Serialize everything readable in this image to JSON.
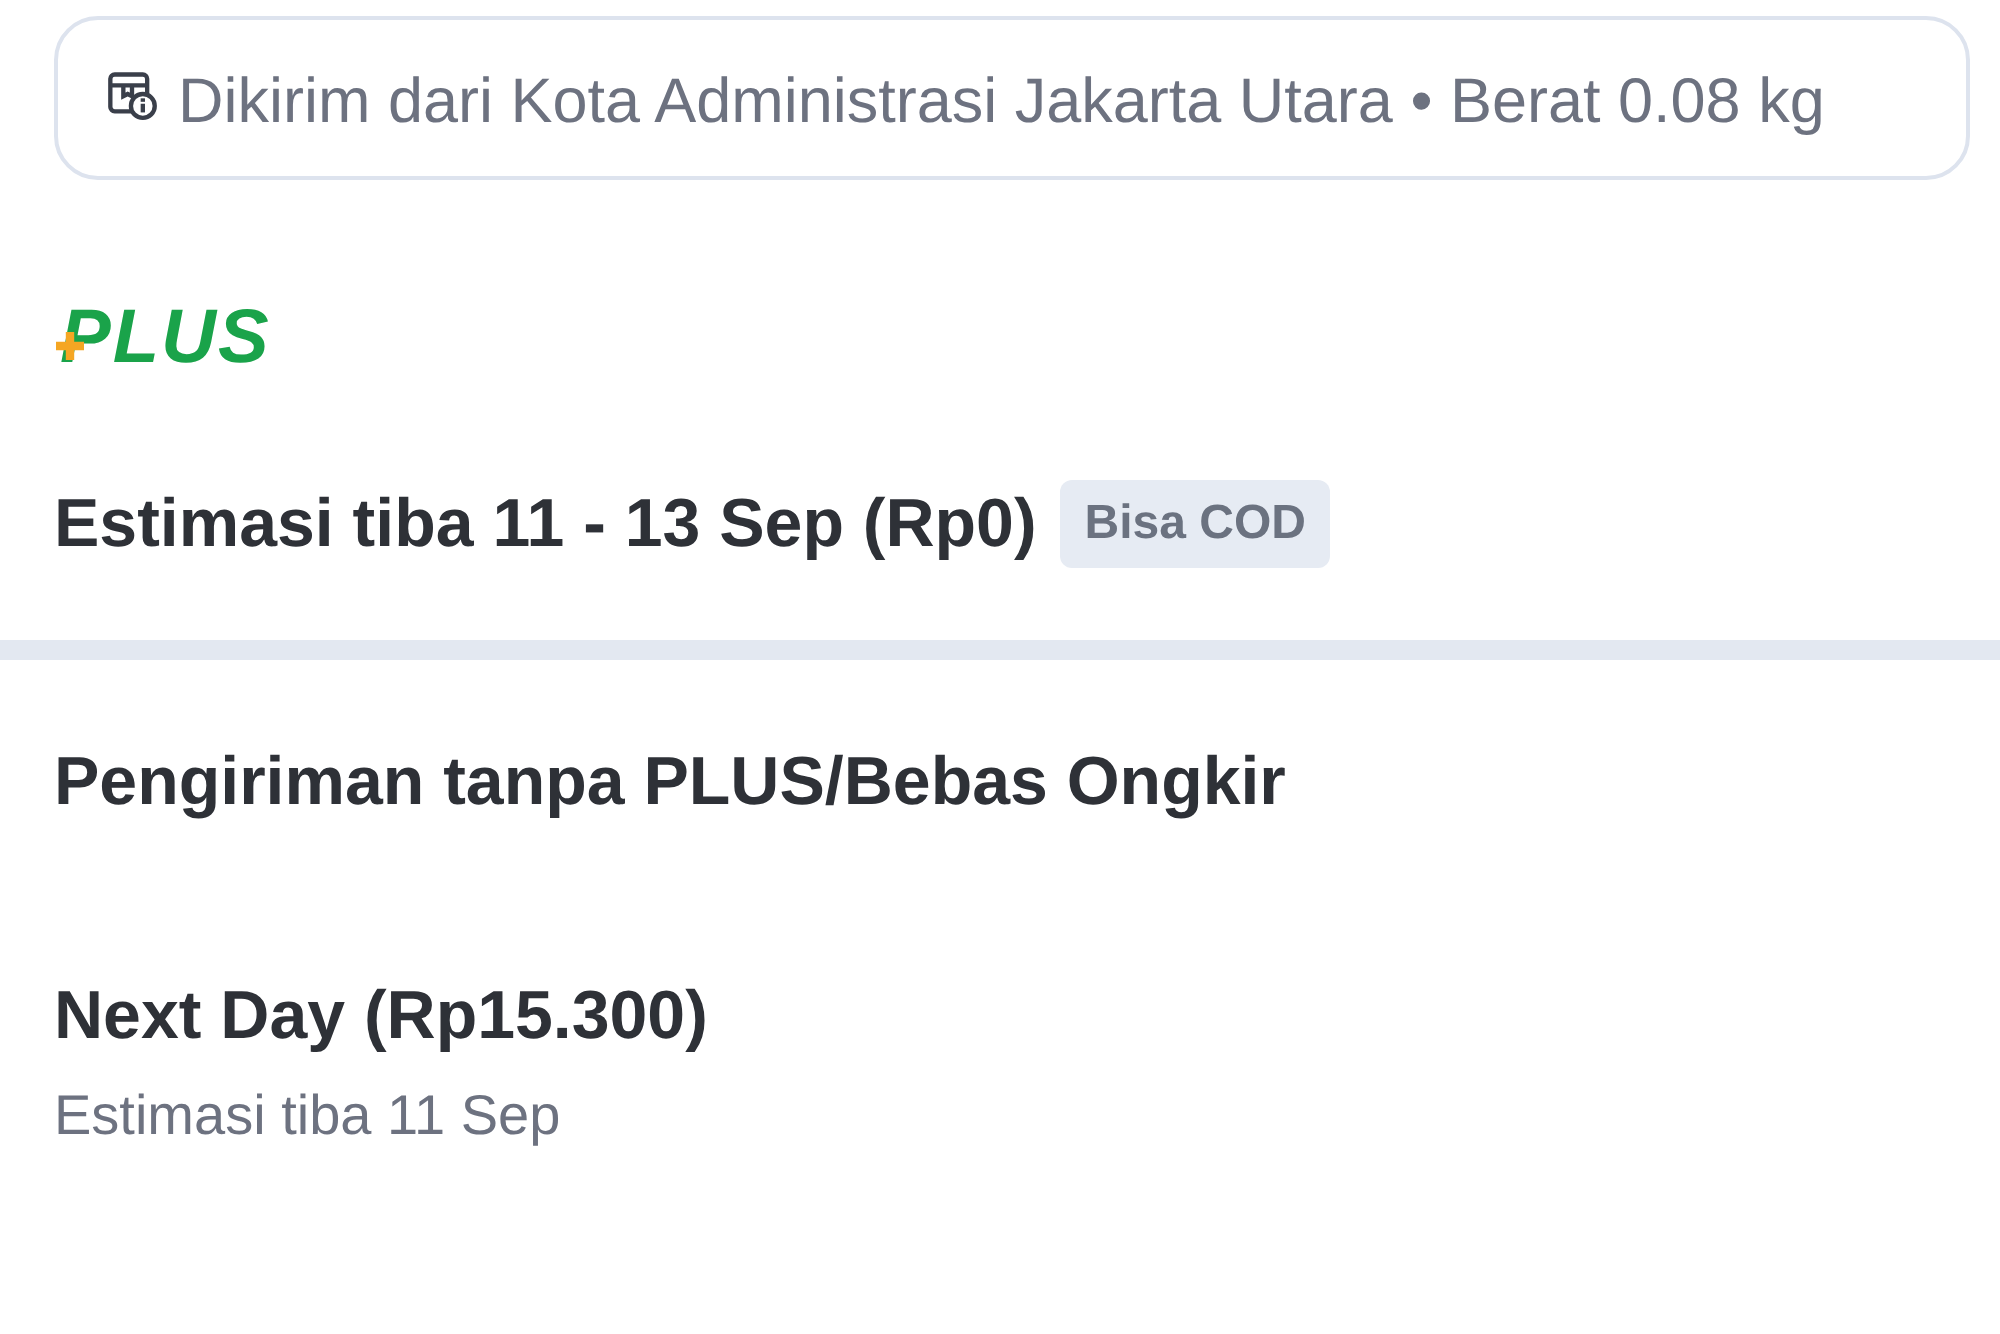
{
  "origin_card": {
    "text": "Dikirim dari Kota Administrasi Jakarta Utara • Berat 0.08 kg"
  },
  "plus_section": {
    "logo": "PLUS",
    "estimate": "Estimasi tiba 11 - 13 Sep (Rp0)",
    "badge": "Bisa COD"
  },
  "other_section": {
    "title": "Pengiriman tanpa PLUS/Bebas Ongkir",
    "options": [
      {
        "name": "Next Day (Rp15.300)",
        "estimate": "Estimasi tiba 11 Sep"
      }
    ]
  }
}
